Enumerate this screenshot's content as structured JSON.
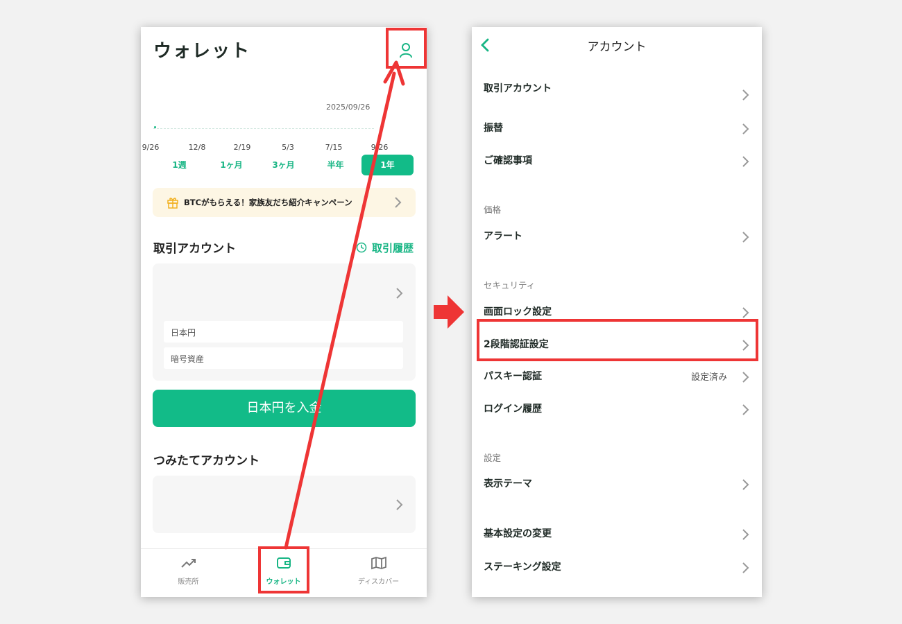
{
  "wallet": {
    "title": "ウォレット",
    "chart": {
      "date_label": "2025/09/26",
      "xticks": [
        "9/26",
        "12/8",
        "2/19",
        "5/3",
        "7/15",
        "9/26"
      ]
    },
    "range_tabs": [
      {
        "label": "1週",
        "active": false
      },
      {
        "label": "1ヶ月",
        "active": false
      },
      {
        "label": "3ヶ月",
        "active": false
      },
      {
        "label": "半年",
        "active": false
      },
      {
        "label": "1年",
        "active": true
      }
    ],
    "campaign": {
      "text": "BTCがもらえる！家族友だち紹介キャンペーン",
      "icon": "gift-icon"
    },
    "trade_account": {
      "title": "取引アカウント",
      "history_link": "取引履歴",
      "rows": [
        "日本円",
        "暗号資産"
      ]
    },
    "deposit_button": "日本円を入金",
    "tsumitate": {
      "title": "つみたてアカウント"
    },
    "bottom_nav": [
      {
        "label": "販売所",
        "icon": "trend-chart-icon",
        "active": false
      },
      {
        "label": "ウォレット",
        "icon": "wallet-icon",
        "active": true
      },
      {
        "label": "ディスカバー",
        "icon": "map-icon",
        "active": false
      }
    ]
  },
  "account": {
    "title": "アカウント",
    "groups": [
      {
        "header": "",
        "items": [
          {
            "label": "取引アカウント",
            "value": ""
          },
          {
            "label": "振替",
            "value": ""
          },
          {
            "label": "ご確認事項",
            "value": ""
          }
        ]
      },
      {
        "header": "価格",
        "items": [
          {
            "label": "アラート",
            "value": ""
          }
        ]
      },
      {
        "header": "セキュリティ",
        "items": [
          {
            "label": "画面ロック設定",
            "value": ""
          },
          {
            "label": "2段階認証設定",
            "value": ""
          },
          {
            "label": "パスキー認証",
            "value": "設定済み"
          },
          {
            "label": "ログイン履歴",
            "value": ""
          }
        ]
      },
      {
        "header": "設定",
        "items": [
          {
            "label": "表示テーマ",
            "value": ""
          },
          {
            "label": "基本設定の変更",
            "value": ""
          },
          {
            "label": "ステーキング設定",
            "value": ""
          }
        ]
      }
    ]
  },
  "colors": {
    "brand_green": "#12bb88",
    "highlight_red": "#ee3535",
    "campaign_bg": "#fdf6e4"
  }
}
